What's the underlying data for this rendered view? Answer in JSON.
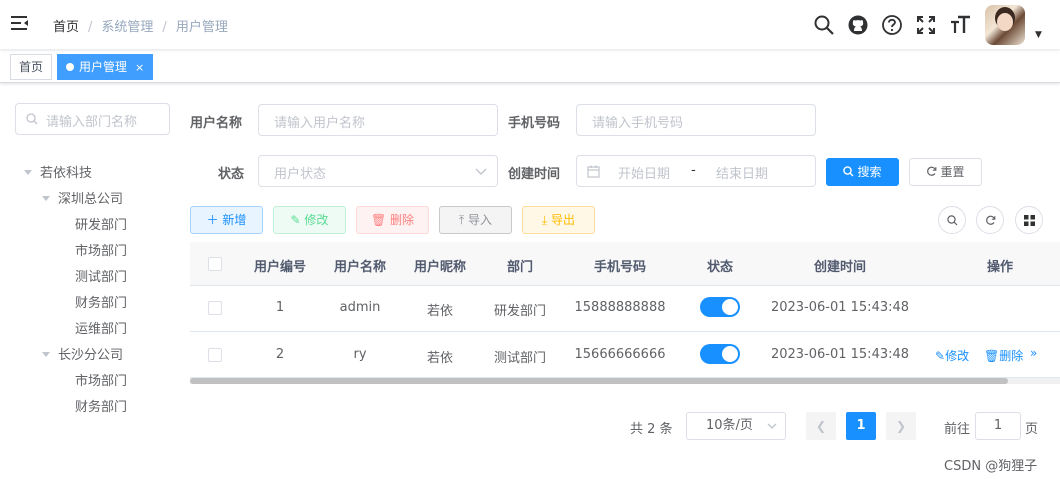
{
  "navbar": {
    "breadcrumb": [
      "首页",
      "系统管理",
      "用户管理"
    ]
  },
  "tags": [
    {
      "label": "首页",
      "active": false
    },
    {
      "label": "用户管理",
      "active": true,
      "close": "×"
    }
  ],
  "dept_tree": {
    "search_placeholder": "请输入部门名称",
    "nodes": [
      {
        "label": "若依科技",
        "level": 0,
        "expanded": true
      },
      {
        "label": "深圳总公司",
        "level": 1,
        "expanded": true
      },
      {
        "label": "研发部门",
        "level": 2
      },
      {
        "label": "市场部门",
        "level": 2
      },
      {
        "label": "测试部门",
        "level": 2
      },
      {
        "label": "财务部门",
        "level": 2
      },
      {
        "label": "运维部门",
        "level": 2
      },
      {
        "label": "长沙分公司",
        "level": 1,
        "expanded": true
      },
      {
        "label": "市场部门",
        "level": 2
      },
      {
        "label": "财务部门",
        "level": 2
      }
    ]
  },
  "search_form": {
    "username_label": "用户名称",
    "username_placeholder": "请输入用户名称",
    "phone_label": "手机号码",
    "phone_placeholder": "请输入手机号码",
    "status_label": "状态",
    "status_placeholder": "用户状态",
    "created_label": "创建时间",
    "start_placeholder": "开始日期",
    "range_sep": "-",
    "end_placeholder": "结束日期",
    "search_button": "搜索",
    "reset_button": "重置"
  },
  "toolbar": {
    "add": "新增",
    "edit": "修改",
    "delete": "删除",
    "import": "导入",
    "export": "导出"
  },
  "table": {
    "headers": [
      "用户编号",
      "用户名称",
      "用户昵称",
      "部门",
      "手机号码",
      "状态",
      "创建时间",
      "操作"
    ],
    "rows": [
      {
        "id": "1",
        "username": "admin",
        "nickname": "若依",
        "dept": "研发部门",
        "phone": "15888888888",
        "status_on": true,
        "created": "2023-06-01 15:43:48"
      },
      {
        "id": "2",
        "username": "ry",
        "nickname": "若依",
        "dept": "测试部门",
        "phone": "15666666666",
        "status_on": true,
        "created": "2023-06-01 15:43:48",
        "ops": [
          "修改",
          "删除",
          "»"
        ]
      }
    ]
  },
  "pagination": {
    "total": "共 2 条",
    "page_size": "10条/页",
    "current_page": "1",
    "goto_label": "前往",
    "goto_value": "1",
    "page_suffix": "页"
  },
  "watermark": "CSDN @狗狸子",
  "colors": {
    "primary": "#1890ff",
    "tag_active": "#409eff"
  }
}
